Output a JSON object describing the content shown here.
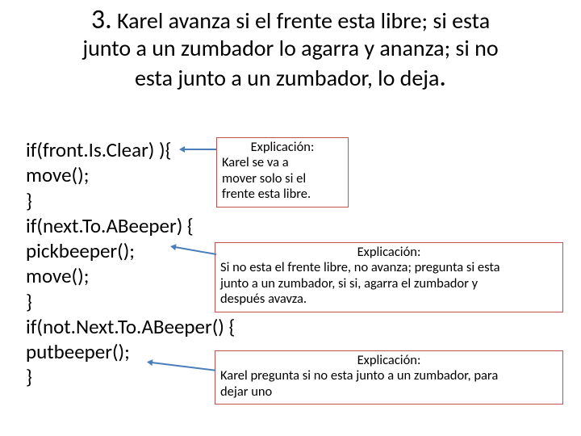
{
  "title": {
    "num": "3.",
    "text_line1": " Karel avanza si el frente esta libre; si esta",
    "text_line2": "junto a un zumbador lo agarra y ananza; si no",
    "text_line3": "esta junto a un zumbador, lo deja",
    "final_dot": "."
  },
  "code": {
    "l1": "if(front.Is.Clear) ){",
    "l2": "move();",
    "l3": "}",
    "l4": "if(next.To.ABeeper) {",
    "l5": "pickbeeper();",
    "l6": "move();",
    "l7": "}",
    "l8": "if(not.Next.To.ABeeper() {",
    "l9": "putbeeper();",
    "l10": "}"
  },
  "box1": {
    "hdr": "Explicación:",
    "b1": "Karel se va a",
    "b2": "mover solo si el",
    "b3": "frente esta libre."
  },
  "box2": {
    "hdr": "Explicación:",
    "b1": "Si no esta el frente libre, no avanza; pregunta si esta",
    "b2": "junto a un zumbador, si si, agarra el zumbador y",
    "b3": "después avavza."
  },
  "box3": {
    "hdr": "Explicación:",
    "b1": "Karel pregunta si no esta junto a un zumbador, para",
    "b2": "dejar uno"
  }
}
